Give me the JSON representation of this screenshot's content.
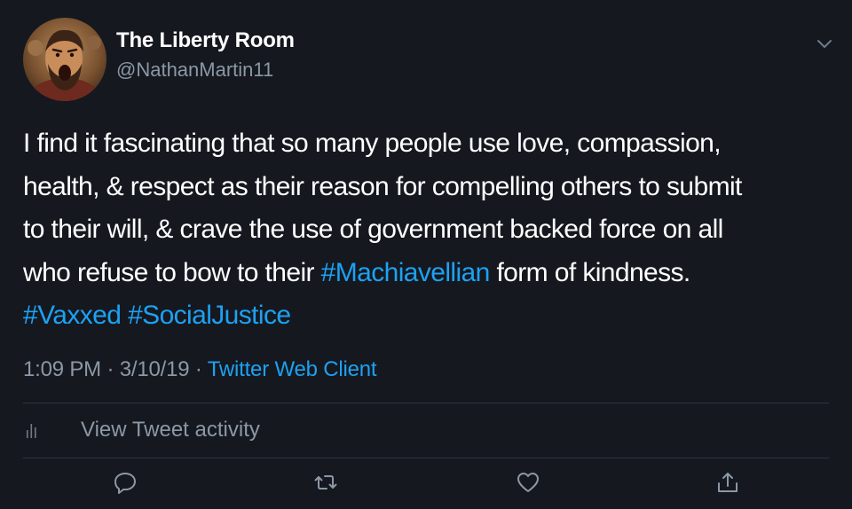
{
  "tweet": {
    "display_name": "The Liberty Room",
    "handle": "@NathanMartin11",
    "text_lines": [
      [
        {
          "t": "I find it fascinating that so many people use love, compassion,",
          "tag": false
        }
      ],
      [
        {
          "t": "health, & respect as their reason for compelling others to submit",
          "tag": false
        }
      ],
      [
        {
          "t": "to their will, & crave the use of government backed force on all",
          "tag": false
        }
      ],
      [
        {
          "t": "who refuse to bow to their ",
          "tag": false
        },
        {
          "t": "#Machiavellian",
          "tag": true
        },
        {
          "t": " form of kindness.",
          "tag": false
        }
      ],
      [
        {
          "t": "#Vaxxed",
          "tag": true
        },
        {
          "t": " ",
          "tag": false
        },
        {
          "t": "#SocialJustice",
          "tag": true
        }
      ]
    ],
    "time": "1:09 PM",
    "date": "3/10/19",
    "separator": "·",
    "source": "Twitter Web Client"
  },
  "activity": {
    "label": "View Tweet activity"
  },
  "icons": {
    "avatar": "profile-avatar",
    "menu": "chevron-down-icon",
    "activity": "bar-chart-icon",
    "reply": "reply-icon",
    "retweet": "retweet-icon",
    "like": "heart-icon",
    "share": "share-icon"
  },
  "colors": {
    "background": "#15181f",
    "text": "#ffffff",
    "secondary": "#8b98a5",
    "link": "#1da1f2",
    "divider": "#2c3440"
  }
}
